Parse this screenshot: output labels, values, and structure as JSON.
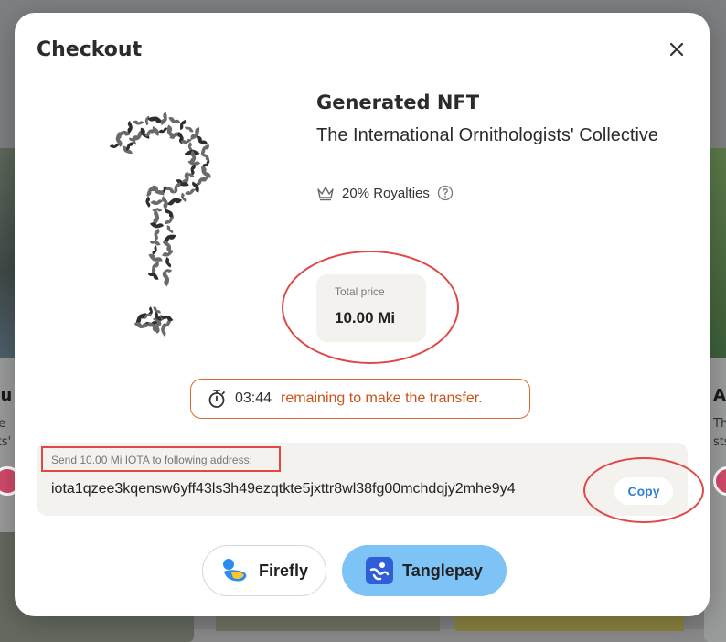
{
  "modal": {
    "title": "Checkout"
  },
  "nft": {
    "name": "Generated NFT",
    "collection": "The International Ornithologists' Collective",
    "royalties": "20% Royalties"
  },
  "price": {
    "label": "Total price",
    "value": "10.00 Mi"
  },
  "timer": {
    "time": "03:44",
    "message": "remaining to make the transfer."
  },
  "transfer": {
    "label": "Send 10.00 Mi IOTA to following address:",
    "address": "iota1qzee3kqensw6yff43ls3h49ezqtkte5jxttr8wl38fg00mchdqjy2mhe9y4",
    "copy_label": "Copy"
  },
  "wallets": [
    {
      "label": "Firefly",
      "icon": "firefly-icon"
    },
    {
      "label": "Tanglepay",
      "icon": "tanglepay-icon"
    }
  ],
  "background": {
    "left_card_title": "zu",
    "left_card_text": [
      "he",
      "sts'"
    ],
    "right_card_title": "A",
    "right_card_text": [
      "Th",
      "sts"
    ]
  },
  "colors": {
    "accent_blue": "#2f7fd6",
    "tanglepay_bg": "#7ec3f6",
    "timer_orange": "#c9531a",
    "annotation_red": "#e04848"
  }
}
